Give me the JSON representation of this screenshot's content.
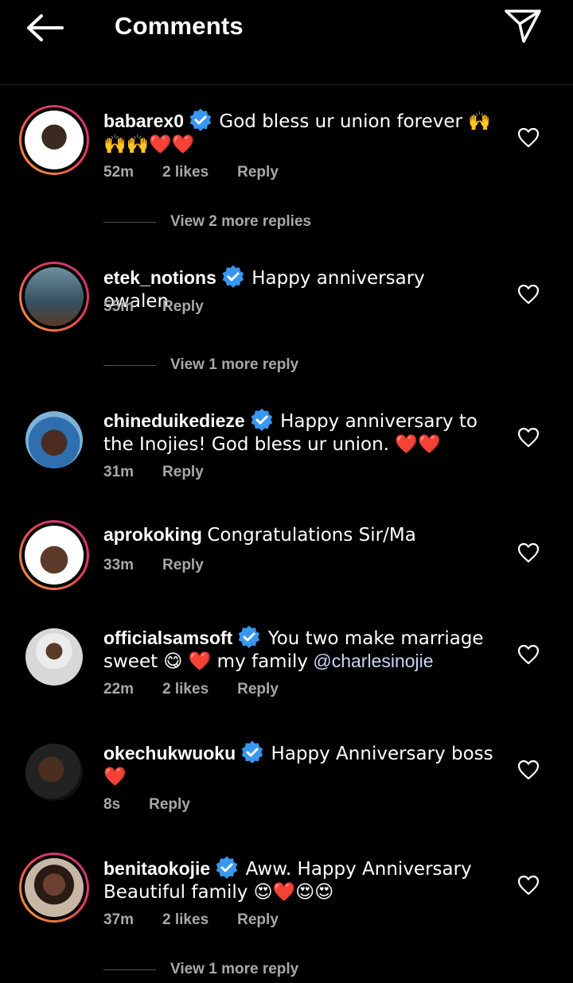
{
  "header": {
    "title": "Comments"
  },
  "comments": [
    {
      "username": "babarex0",
      "verified": true,
      "text": "God bless ur union forever 🙌🙌🙌❤️❤️",
      "time": "52m",
      "likes": "2 likes",
      "reply": "Reply",
      "view_replies": "View 2 more replies"
    },
    {
      "username": "etek_notions",
      "verified": true,
      "text": "Happy anniversary owalen",
      "time": "55m",
      "likes": "",
      "reply": "Reply",
      "view_replies": "View 1 more reply"
    },
    {
      "username": "chineduikedieze",
      "verified": true,
      "text": "Happy anniversary to the Inojies! God bless ur union. ❤️❤️",
      "time": "31m",
      "likes": "",
      "reply": "Reply",
      "view_replies": ""
    },
    {
      "username": "aprokoking",
      "verified": false,
      "text": "Congratulations Sir/Ma",
      "time": "33m",
      "likes": "",
      "reply": "Reply",
      "view_replies": ""
    },
    {
      "username": "officialsamsoft",
      "verified": true,
      "text": "You two make marriage sweet 😋 ❤️ my family",
      "mention": "@charlesinojie",
      "time": "22m",
      "likes": "2 likes",
      "reply": "Reply",
      "view_replies": ""
    },
    {
      "username": "okechukwuoku",
      "verified": true,
      "text": "Happy Anniversary boss ❤️",
      "time": "8s",
      "likes": "",
      "reply": "Reply",
      "view_replies": ""
    },
    {
      "username": "benitaokojie",
      "verified": true,
      "text": "Aww. Happy Anniversary Beautiful family 😍❤️😍😍",
      "time": "37m",
      "likes": "2 likes",
      "reply": "Reply",
      "view_replies": "View 1 more reply"
    }
  ],
  "colors": {
    "background": "#000000",
    "secondary_text": "#a8a8a8",
    "verified_blue": "#3897f0",
    "mention": "#c7d7f5"
  },
  "icons": [
    "back-arrow-icon",
    "send-icon",
    "verified-badge-icon",
    "heart-icon"
  ]
}
